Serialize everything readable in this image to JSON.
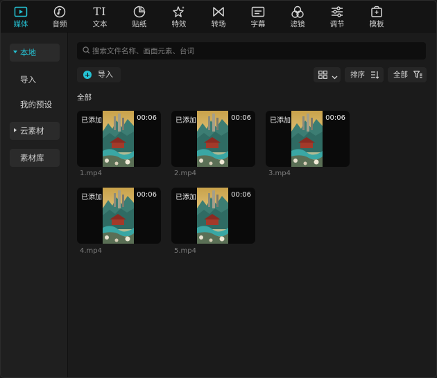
{
  "toolbar": {
    "tabs": [
      {
        "label": "媒体",
        "icon": "media-icon",
        "active": true
      },
      {
        "label": "音频",
        "icon": "audio-icon"
      },
      {
        "label": "文本",
        "icon": "text-icon"
      },
      {
        "label": "贴纸",
        "icon": "sticker-icon"
      },
      {
        "label": "特效",
        "icon": "effects-icon"
      },
      {
        "label": "转场",
        "icon": "transition-icon"
      },
      {
        "label": "字幕",
        "icon": "subtitle-icon"
      },
      {
        "label": "滤镜",
        "icon": "filter-icon"
      },
      {
        "label": "调节",
        "icon": "adjust-icon"
      },
      {
        "label": "模板",
        "icon": "template-icon"
      }
    ],
    "text_icon_glyph": "TI"
  },
  "sidebar": {
    "local": "本地",
    "import": "导入",
    "presets": "我的预设",
    "cloud": "云素材",
    "library": "素材库"
  },
  "main": {
    "search_placeholder": "搜索文件名称、画面元素、台词",
    "import_label": "导入",
    "sort_label": "排序",
    "filter_label": "全部",
    "section_title": "全部"
  },
  "media": [
    {
      "name": "1.mp4",
      "status": "已添加",
      "duration": "00:06"
    },
    {
      "name": "2.mp4",
      "status": "已添加",
      "duration": "00:06"
    },
    {
      "name": "3.mp4",
      "status": "已添加",
      "duration": "00:06"
    },
    {
      "name": "4.mp4",
      "status": "已添加",
      "duration": "00:06"
    },
    {
      "name": "5.mp4",
      "status": "已添加",
      "duration": "00:06"
    }
  ],
  "colors": {
    "accent": "#25c2d4",
    "background": "#1b1b1b",
    "toolbar": "#141414"
  }
}
